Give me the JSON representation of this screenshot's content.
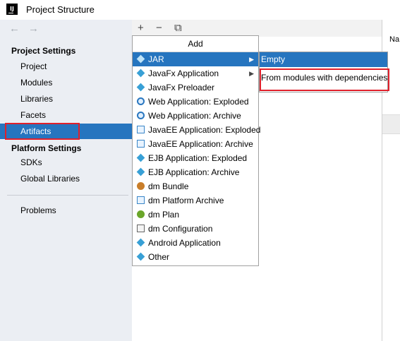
{
  "window": {
    "title": "Project Structure",
    "app_icon": "IJ"
  },
  "nav": {
    "back": "←",
    "forward": "→"
  },
  "sidebar": {
    "project_settings_label": "Project Settings",
    "items": [
      "Project",
      "Modules",
      "Libraries",
      "Facets",
      "Artifacts"
    ],
    "platform_settings_label": "Platform Settings",
    "platform_items": [
      "SDKs",
      "Global Libraries"
    ],
    "problems_label": "Problems",
    "selected": "Artifacts"
  },
  "toolbar": {
    "add": "+",
    "remove": "−",
    "copy": "⧉"
  },
  "add_menu": {
    "header": "Add",
    "items": [
      {
        "label": "JAR",
        "icon": "diamond-icon",
        "submenu": true,
        "active": true
      },
      {
        "label": "JavaFx Application",
        "icon": "diamond-icon",
        "submenu": true
      },
      {
        "label": "JavaFx Preloader",
        "icon": "diamond-icon"
      },
      {
        "label": "Web Application: Exploded",
        "icon": "globe-icon"
      },
      {
        "label": "Web Application: Archive",
        "icon": "globe-icon"
      },
      {
        "label": "JavaEE Application: Exploded",
        "icon": "jar-icon"
      },
      {
        "label": "JavaEE Application: Archive",
        "icon": "jar-icon"
      },
      {
        "label": "EJB Application: Exploded",
        "icon": "diamond-icon"
      },
      {
        "label": "EJB Application: Archive",
        "icon": "diamond-icon"
      },
      {
        "label": "dm Bundle",
        "icon": "bundle-icon"
      },
      {
        "label": "dm Platform Archive",
        "icon": "jar-icon"
      },
      {
        "label": "dm Plan",
        "icon": "plan-icon"
      },
      {
        "label": "dm Configuration",
        "icon": "doc-icon"
      },
      {
        "label": "Android Application",
        "icon": "diamond-icon"
      },
      {
        "label": "Other",
        "icon": "diamond-icon"
      }
    ]
  },
  "jar_submenu": {
    "items": [
      "Empty",
      "From modules with dependencies..."
    ]
  },
  "right_panel": {
    "label": "Na"
  },
  "colors": {
    "selection": "#2675bf",
    "highlight": "#e0202b",
    "sidebar_bg": "#ebeef3"
  }
}
